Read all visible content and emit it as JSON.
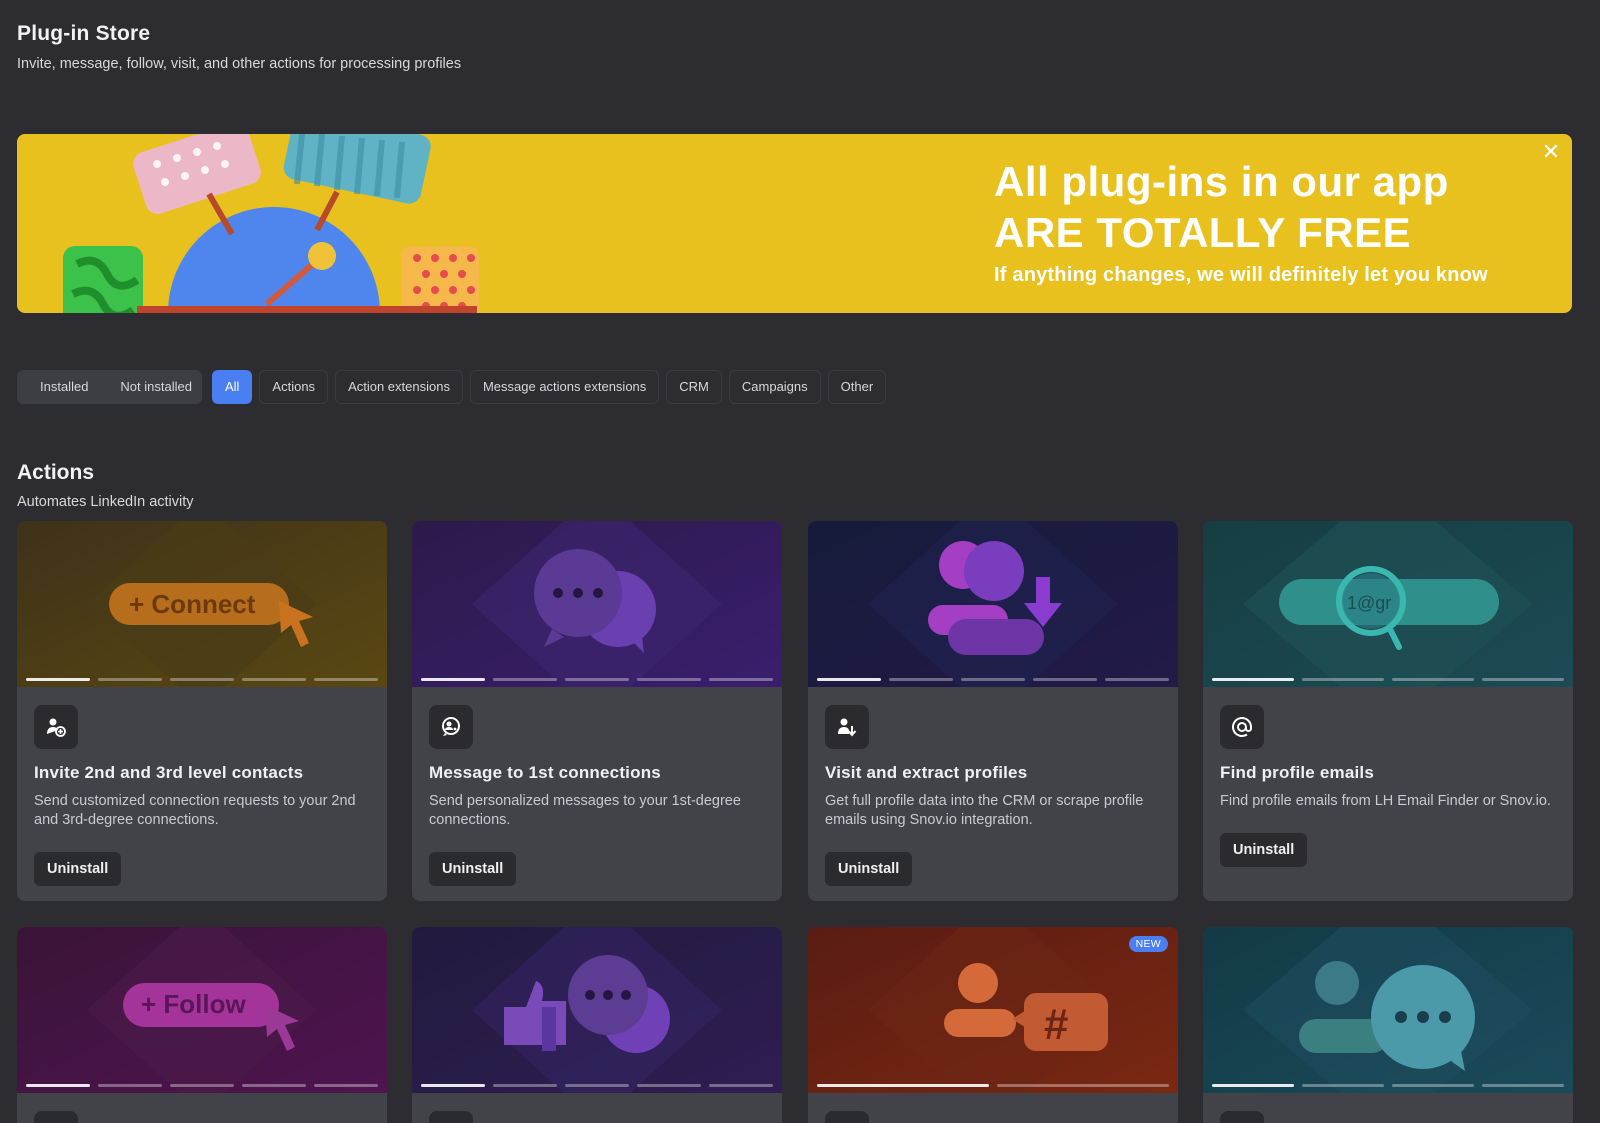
{
  "header": {
    "title": "Plug-in Store",
    "subtitle": "Invite, message, follow, visit, and other actions for processing profiles"
  },
  "banner": {
    "headline_1": "All plug-ins in our app",
    "headline_2": "ARE TOTALLY FREE",
    "sub": "If anything changes, we will definitely let you know",
    "close_icon": "close-icon"
  },
  "filters": {
    "segmented": [
      "Installed",
      "Not installed"
    ],
    "chips": [
      "All",
      "Actions",
      "Action extensions",
      "Message actions extensions",
      "CRM",
      "Campaigns",
      "Other"
    ],
    "active_chip": "All"
  },
  "section": {
    "title": "Actions",
    "subtitle": "Automates LinkedIn activity"
  },
  "cards": [
    {
      "title": "Invite 2nd and 3rd level contacts",
      "desc": "Send customized connection requests to your 2nd and 3rd-degree connections.",
      "button": "Uninstall",
      "icon": "invite-user-icon",
      "image_text": "+ Connect",
      "carousel_slides": 5,
      "carousel_active": 1
    },
    {
      "title": "Message to 1st connections",
      "desc": "Send personalized messages to your 1st-degree connections.",
      "button": "Uninstall",
      "icon": "message-user-icon",
      "carousel_slides": 5,
      "carousel_active": 1
    },
    {
      "title": "Visit and extract profiles",
      "desc": "Get full profile data into the CRM or scrape profile emails using Snov.io integration.",
      "button": "Uninstall",
      "icon": "extract-user-icon",
      "carousel_slides": 5,
      "carousel_active": 1
    },
    {
      "title": "Find profile emails",
      "desc": "Find profile emails from LH Email Finder or Snov.io.",
      "button": "Uninstall",
      "icon": "at-sign-icon",
      "image_text": "1@gr",
      "carousel_slides": 4,
      "carousel_active": 1
    }
  ],
  "cards_row2": [
    {
      "image_text": "+ Follow",
      "carousel_slides": 5,
      "carousel_active": 1
    },
    {
      "carousel_slides": 5,
      "carousel_active": 1
    },
    {
      "badge": "NEW",
      "carousel_slides": 2,
      "carousel_active": 1
    },
    {
      "carousel_slides": 4,
      "carousel_active": 1
    }
  ],
  "colors": {
    "background": "#2c2c31",
    "banner": "#e8c11f",
    "accent": "#4a7ff2",
    "card": "#424249"
  }
}
